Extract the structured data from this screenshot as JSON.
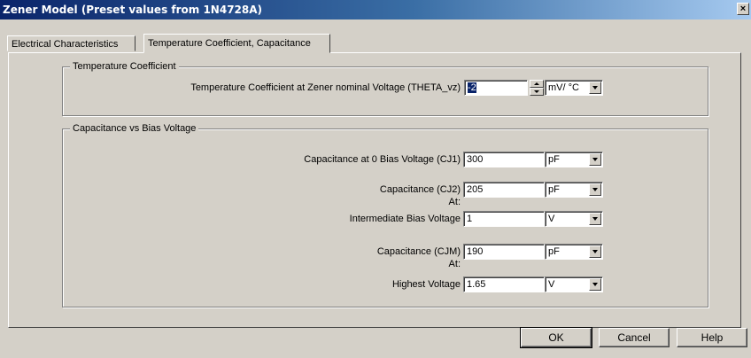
{
  "window": {
    "title": "Zener Model (Preset values from 1N4728A)",
    "close_glyph": "×"
  },
  "tabs": [
    {
      "label": "Electrical Characteristics"
    },
    {
      "label": "Temperature Coefficient, Capacitance"
    }
  ],
  "temp_group": {
    "title": "Temperature Coefficient",
    "label": "Temperature Coefficient at Zener nominal Voltage (THETA_vz)",
    "value": "-2",
    "unit": "mV/ °C"
  },
  "cap_group": {
    "title": "Capacitance vs Bias Voltage",
    "cj1": {
      "label": "Capacitance at 0 Bias Voltage (CJ1)",
      "value": "300",
      "unit": "pF"
    },
    "cj2": {
      "label": "Capacitance (CJ2)",
      "value": "205",
      "unit": "pF"
    },
    "at1": "At:",
    "inter": {
      "label": "Intermediate Bias Voltage",
      "value": "1",
      "unit": "V"
    },
    "cjm": {
      "label": "Capacitance (CJM)",
      "value": "190",
      "unit": "pF"
    },
    "at2": "At:",
    "high": {
      "label": "Highest Voltage",
      "value": "1.65",
      "unit": "V"
    }
  },
  "buttons": {
    "ok": "OK",
    "cancel": "Cancel",
    "help": "Help"
  }
}
